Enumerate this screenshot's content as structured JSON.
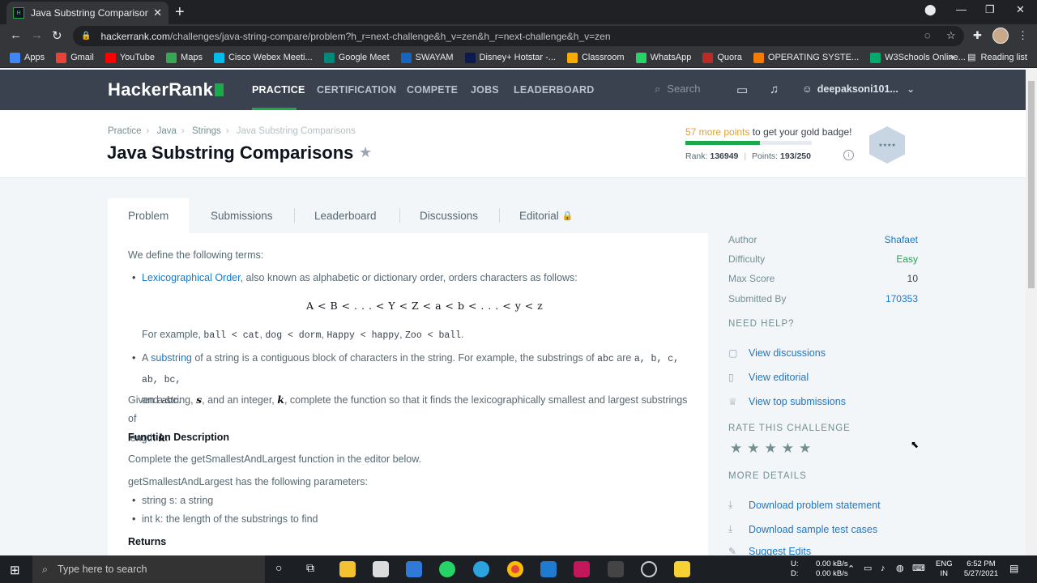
{
  "browser": {
    "tab_title": "Java Substring Comparisons | Ha",
    "url_host": "hackerrank.com",
    "url_path": "/challenges/java-string-compare/problem?h_r=next-challenge&h_v=zen&h_r=next-challenge&h_v=zen",
    "bookmarks": [
      {
        "label": "Apps",
        "color": "#4285f4"
      },
      {
        "label": "Gmail",
        "color": "#ea4335"
      },
      {
        "label": "YouTube",
        "color": "#ff0000"
      },
      {
        "label": "Maps",
        "color": "#34a853"
      },
      {
        "label": "Cisco Webex Meeti...",
        "color": "#00bceb"
      },
      {
        "label": "Google Meet",
        "color": "#00897b"
      },
      {
        "label": "SWAYAM",
        "color": "#1565c0"
      },
      {
        "label": "Disney+ Hotstar -...",
        "color": "#0c1a4e"
      },
      {
        "label": "Classroom",
        "color": "#f9ab00"
      },
      {
        "label": "WhatsApp",
        "color": "#25d366"
      },
      {
        "label": "Quora",
        "color": "#b92b27"
      },
      {
        "label": "OPERATING SYSTE...",
        "color": "#f57c00"
      },
      {
        "label": "W3Schools Online...",
        "color": "#04aa6d"
      }
    ],
    "reading_list": "Reading list"
  },
  "nav": {
    "logo": "HackerRank",
    "links": [
      "PRACTICE",
      "CERTIFICATION",
      "COMPETE",
      "JOBS",
      "LEADERBOARD"
    ],
    "search_placeholder": "Search",
    "username": "deepaksoni101..."
  },
  "header": {
    "breadcrumbs": [
      "Practice",
      "Java",
      "Strings",
      "Java Substring Comparisons"
    ],
    "title": "Java Substring Comparisons",
    "points_needed": "57 more points",
    "badge_text": " to get your gold badge!",
    "rank_label": "Rank:",
    "rank_value": "136949",
    "points_label": "Points:",
    "points_value": "193/250",
    "progress": 0.59
  },
  "tabs": [
    "Problem",
    "Submissions",
    "Leaderboard",
    "Discussions",
    "Editorial"
  ],
  "problem": {
    "intro": "We define the following terms:",
    "lex_link": "Lexicographical Order",
    "lex_rest": ", also known as alphabetic or dictionary order, orders characters as follows:",
    "formula": "A < B < . . . < Y < Z < a < b < . . . < y < z",
    "example_prefix": "For example, ",
    "examples": [
      "ball < cat",
      "dog < dorm",
      "Happy < happy",
      "Zoo < ball"
    ],
    "sub_prefix": "A ",
    "sub_link": "substring",
    "sub_rest": " of a string is a contiguous block of characters in the string. For example, the substrings of ",
    "sub_abc": "abc",
    "sub_are": " are ",
    "sub_list": "a, b, c, ab, bc,",
    "sub_and": "and ",
    "given": "Given a string, ",
    "var_s": "s",
    "given2": ", and an integer, ",
    "var_k": "k",
    "given3": ", complete the function so that it finds the lexicographically smallest and largest substrings of",
    "length": "length ",
    "func_desc_hdr": "Function Description",
    "func_desc": "Complete the getSmallestAndLargest function in the editor below.",
    "params_intro": "getSmallestAndLargest has the following parameters:",
    "param1": "string s: a string",
    "param2": "int k: the length of the substrings to find",
    "returns_hdr": "Returns"
  },
  "sidebar": {
    "author_label": "Author",
    "author": "Shafaet",
    "difficulty_label": "Difficulty",
    "difficulty": "Easy",
    "maxscore_label": "Max Score",
    "maxscore": "10",
    "submitted_label": "Submitted By",
    "submitted": "170353",
    "need_help": "NEED HELP?",
    "help_links": [
      "View discussions",
      "View editorial",
      "View top submissions"
    ],
    "rate": "RATE THIS CHALLENGE",
    "rating_stars": 5,
    "more": "MORE DETAILS",
    "detail_links": [
      "Download problem statement",
      "Download sample test cases",
      "Suggest Edits"
    ]
  },
  "taskbar": {
    "search_placeholder": "Type here to search",
    "net_up": "0.00 kB/s",
    "net_down": "0.00 kB/s",
    "net_u": "U:",
    "net_d": "D:",
    "lang1": "ENG",
    "lang2": "IN",
    "time": "6:52 PM",
    "date": "5/27/2021"
  },
  "colors": {
    "brand_green": "#1ba94c",
    "nav_bg": "#39424e",
    "link": "#1a77c9",
    "easy": "#1ba94c",
    "points_orange": "#e79d2e"
  }
}
